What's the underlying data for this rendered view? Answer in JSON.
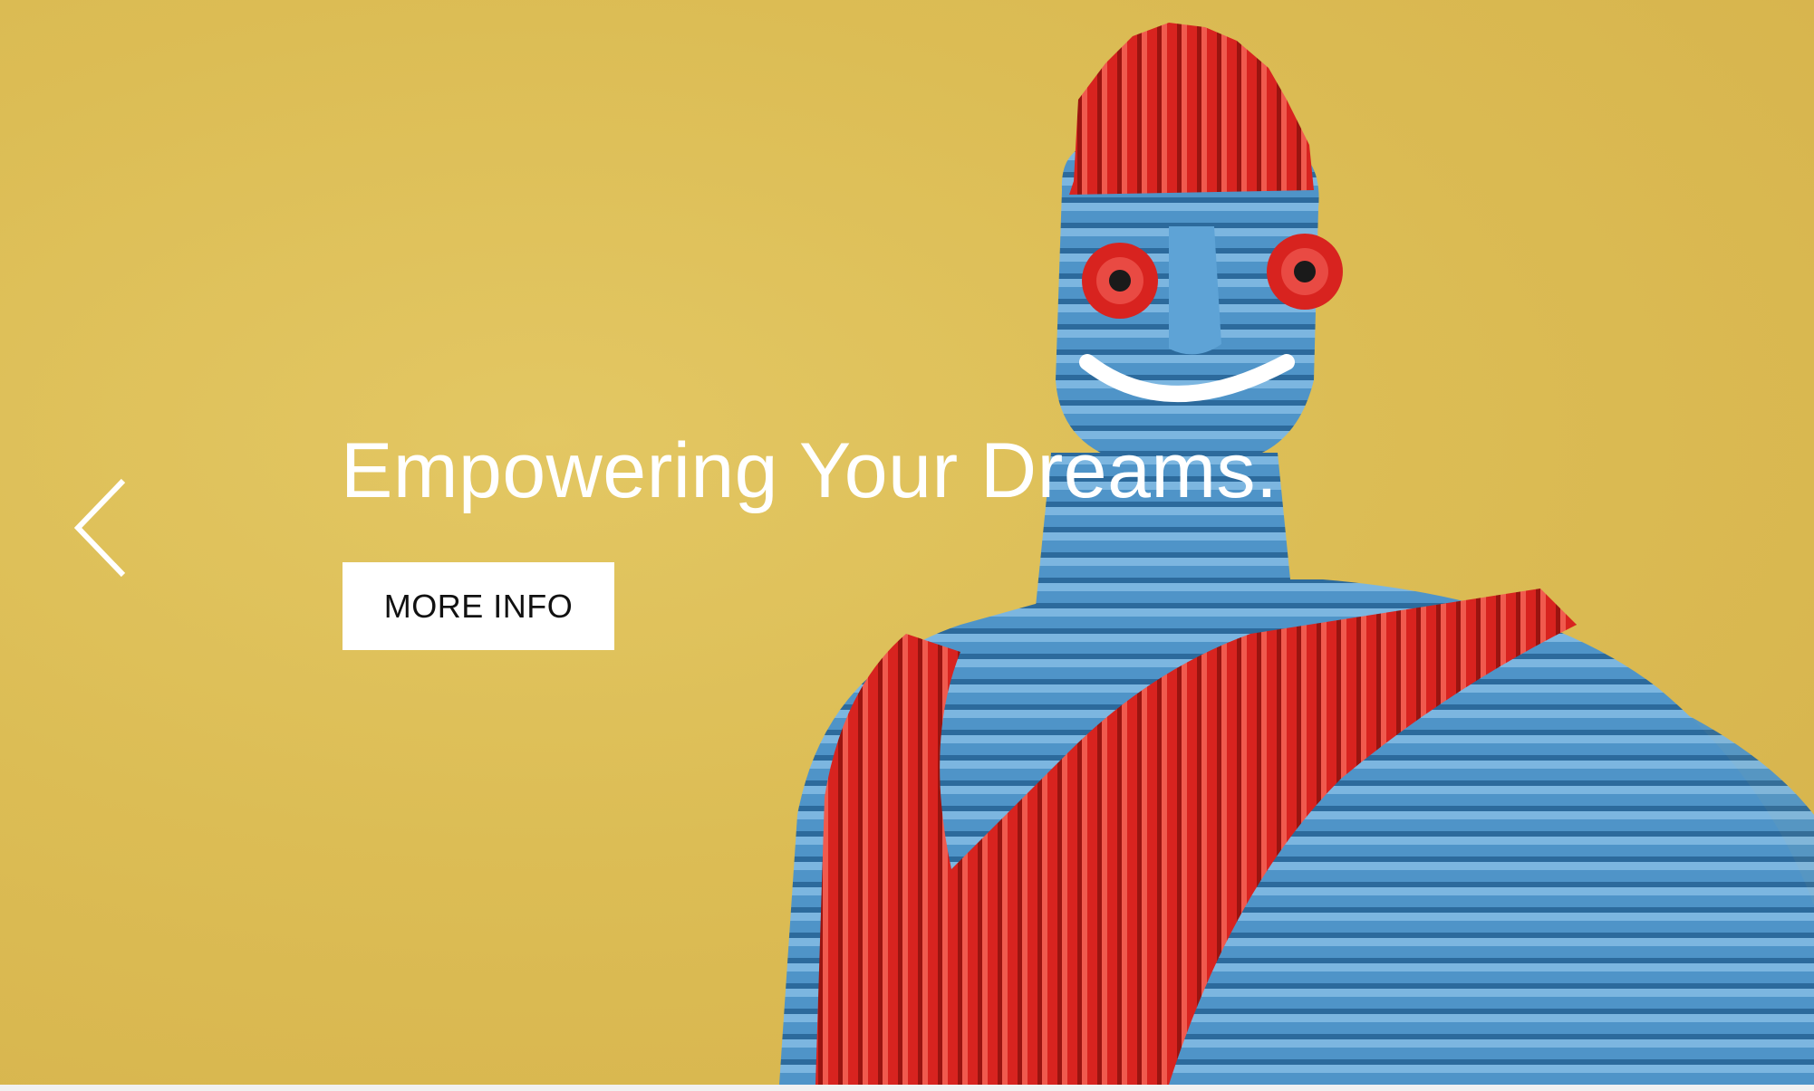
{
  "hero": {
    "headline": "Empowering Your Dreams.",
    "button_label": "MORE INFO",
    "background_color": "#dcbd55"
  },
  "carousel": {
    "prev_icon": "chevron-left-icon"
  },
  "colors": {
    "figure_blue": "#4f94c8",
    "figure_red": "#d8231f",
    "text_white": "#ffffff"
  }
}
